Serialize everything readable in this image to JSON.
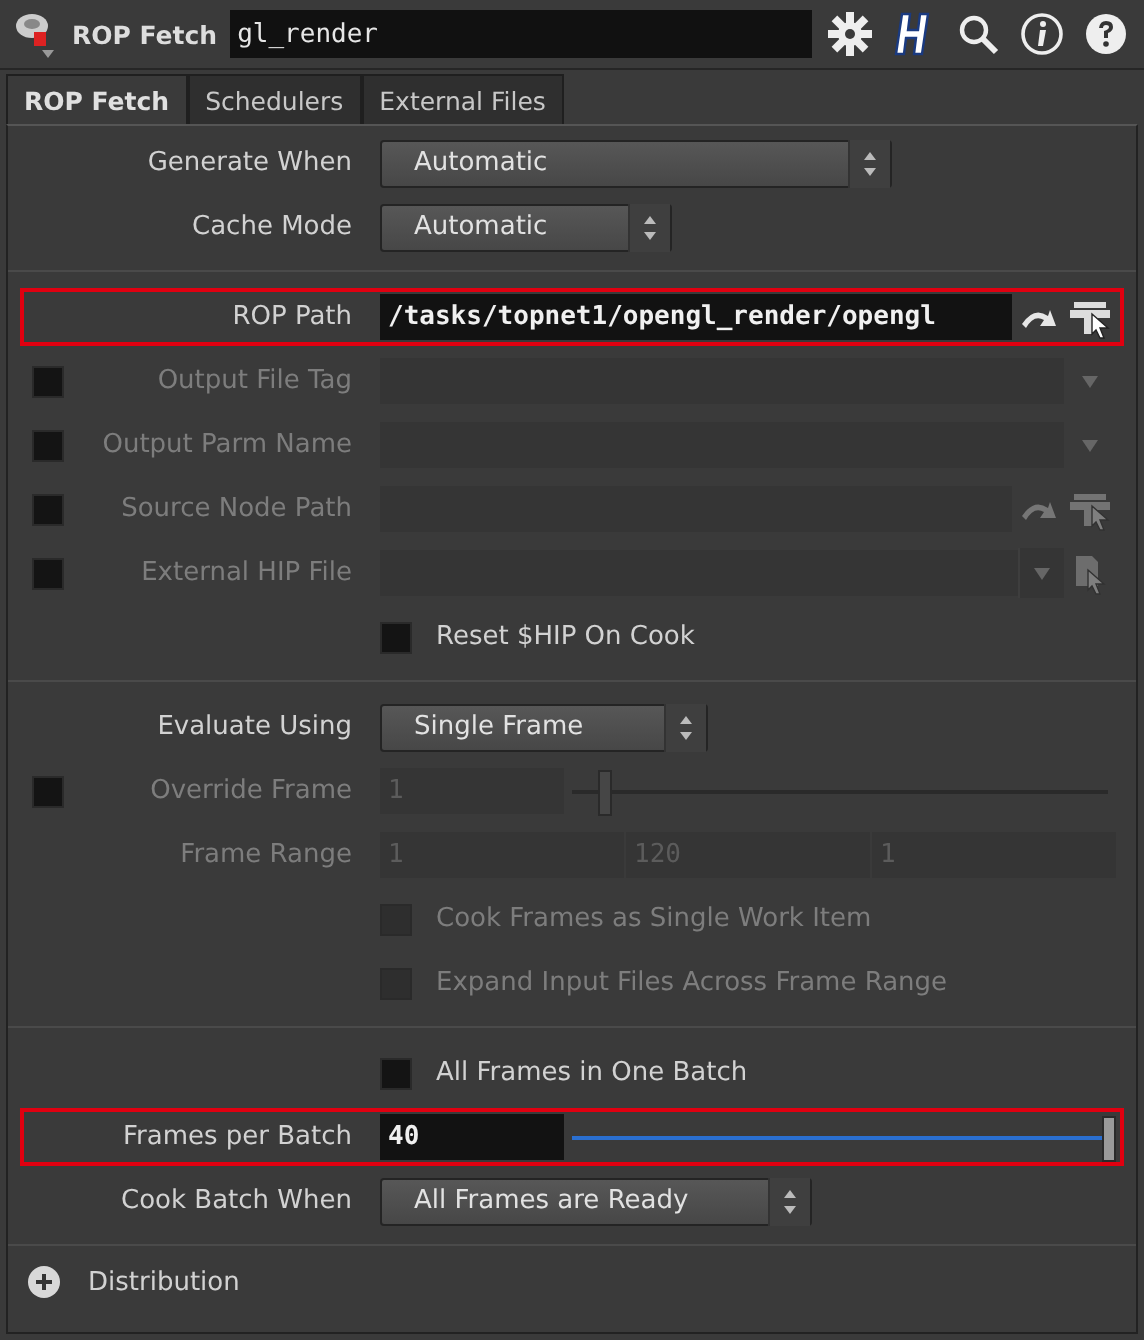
{
  "header": {
    "node_type": "ROP Fetch",
    "node_name": "gl_render"
  },
  "tabs": [
    {
      "label": "ROP Fetch",
      "selected": true
    },
    {
      "label": "Schedulers",
      "selected": false
    },
    {
      "label": "External Files",
      "selected": false
    }
  ],
  "sections": [
    {
      "rows": [
        {
          "kind": "menu",
          "label": "Generate When",
          "value": "Automatic",
          "disabled": false,
          "highlighted": false
        },
        {
          "kind": "menu",
          "label": "Cache Mode",
          "value": "Automatic",
          "disabled": false,
          "highlighted": false
        }
      ]
    },
    {
      "rows": [
        {
          "kind": "path",
          "label": "ROP Path",
          "value": "/tasks/topnet1/opengl_render/opengl",
          "disabled": false,
          "highlighted": true
        },
        {
          "kind": "string_menu",
          "label": "Output File Tag",
          "checked": false,
          "disabled": true,
          "highlighted": false
        },
        {
          "kind": "string_menu",
          "label": "Output Parm Name",
          "checked": false,
          "disabled": true,
          "highlighted": false
        },
        {
          "kind": "path",
          "label": "Source Node Path",
          "checked": false,
          "disabled": true,
          "highlighted": false
        },
        {
          "kind": "file",
          "label": "External HIP File",
          "checked": false,
          "disabled": true,
          "highlighted": false
        },
        {
          "kind": "checkbox",
          "label": "Reset $HIP On Cook",
          "checked": false,
          "disabled": false,
          "highlighted": false
        }
      ]
    },
    {
      "rows": [
        {
          "kind": "menu",
          "label": "Evaluate Using",
          "value": "Single Frame",
          "disabled": false,
          "highlighted": false
        },
        {
          "kind": "slider",
          "label": "Override Frame",
          "value": "1",
          "level": 0.06,
          "checked": false,
          "disabled": true,
          "highlighted": false
        },
        {
          "kind": "range",
          "label": "Frame Range",
          "values": [
            "1",
            "120",
            "1"
          ],
          "disabled": true,
          "highlighted": false
        },
        {
          "kind": "checkbox",
          "label": "Cook Frames as Single Work Item",
          "checked": false,
          "disabled": true,
          "highlighted": false
        },
        {
          "kind": "checkbox",
          "label": "Expand Input Files Across Frame Range",
          "checked": false,
          "disabled": true,
          "highlighted": false
        }
      ]
    },
    {
      "rows": [
        {
          "kind": "checkbox",
          "label": "All Frames in One Batch",
          "checked": false,
          "disabled": false,
          "highlighted": false
        },
        {
          "kind": "slider",
          "label": "Frames per Batch",
          "value": "40",
          "level": 1,
          "disabled": false,
          "highlighted": true
        },
        {
          "kind": "menu",
          "label": "Cook Batch When",
          "value": "All Frames are Ready",
          "disabled": false,
          "highlighted": false
        }
      ]
    }
  ],
  "folder": {
    "label": "Distribution",
    "expanded": false
  }
}
